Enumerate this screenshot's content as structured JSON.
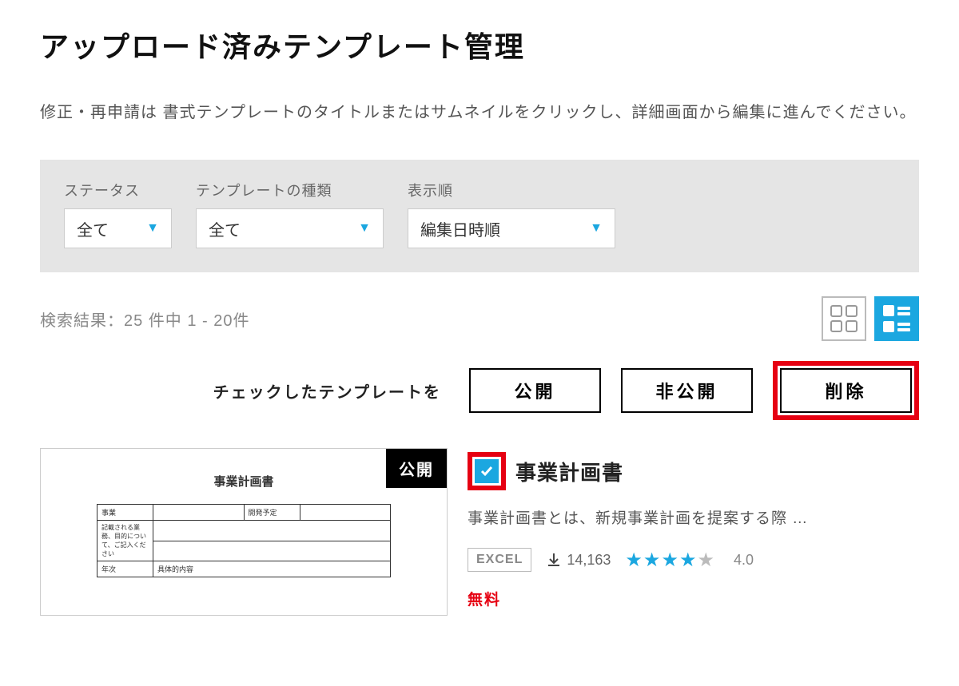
{
  "page": {
    "title": "アップロード済みテンプレート管理",
    "description": "修正・再申請は 書式テンプレートのタイトルまたはサムネイルをクリックし、詳細画面から編集に進んでください。"
  },
  "filters": {
    "status": {
      "label": "ステータス",
      "value": "全て"
    },
    "type": {
      "label": "テンプレートの種類",
      "value": "全て"
    },
    "sort": {
      "label": "表示順",
      "value": "編集日時順"
    }
  },
  "results": {
    "summary": "検索結果：25 件中 1 - 20件"
  },
  "bulk": {
    "label": "チェックしたテンプレートを",
    "publish": "公開",
    "unpublish": "非公開",
    "delete": "削除"
  },
  "item": {
    "status": "公開",
    "checked": true,
    "title": "事業計画書",
    "description": "事業計画書とは、新規事業計画を提案する際 …",
    "format": "EXCEL",
    "downloads": "14,163",
    "rating": "4.0",
    "price": "無料",
    "thumb": {
      "doc_title": "事業計画書",
      "row1a": "事業",
      "row1b": "開発予定",
      "row2a": "記載される業務、目的について、ご記入ください",
      "row3a": "年次",
      "row3b": "具体的内容"
    }
  }
}
